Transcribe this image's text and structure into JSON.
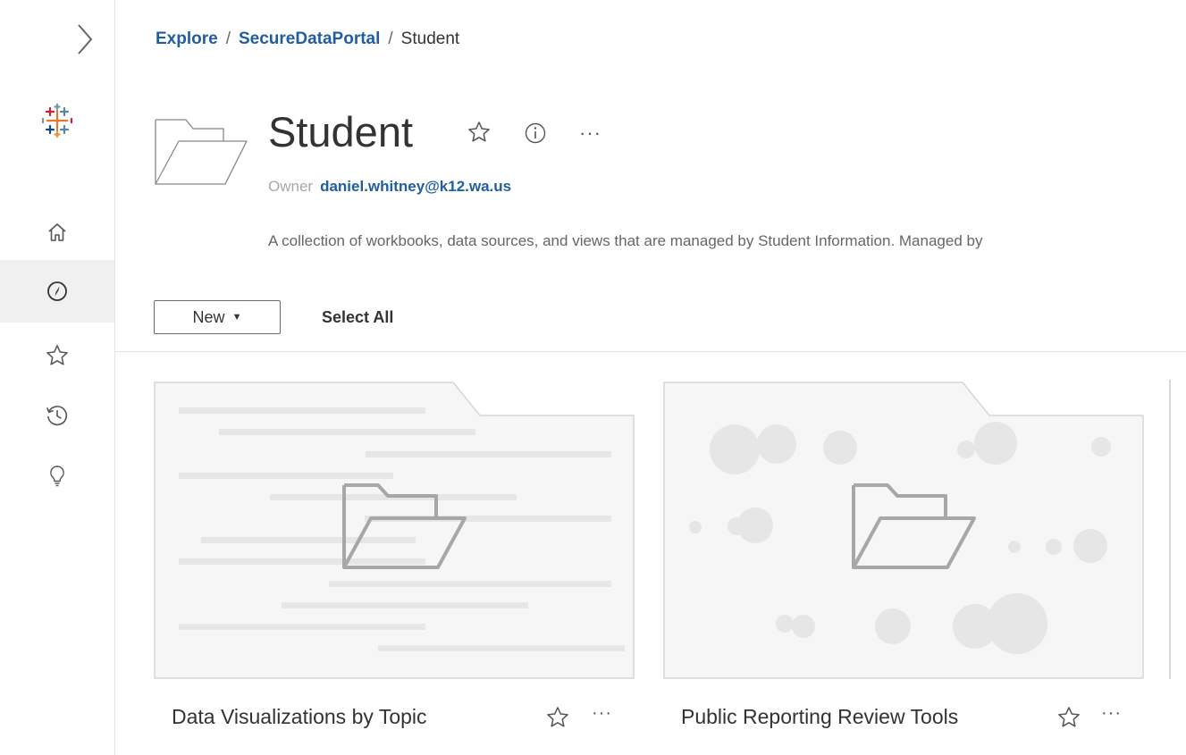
{
  "breadcrumb": {
    "items": [
      "Explore",
      "SecureDataPortal"
    ],
    "separator": "/",
    "current": "Student"
  },
  "project": {
    "title": "Student",
    "owner_label": "Owner",
    "owner": "daniel.whitney@k12.wa.us",
    "description": "A collection of workbooks, data sources, and views that are managed by Student Information. Managed by"
  },
  "toolbar": {
    "new_label": "New",
    "select_all_label": "Select All"
  },
  "cards": [
    {
      "title": "Data Visualizations by Topic"
    },
    {
      "title": "Public Reporting Review Tools"
    }
  ],
  "icons": {
    "more": "···"
  },
  "colors": {
    "link": "#215ea0",
    "sidebar_active": "#f0f0f0"
  }
}
